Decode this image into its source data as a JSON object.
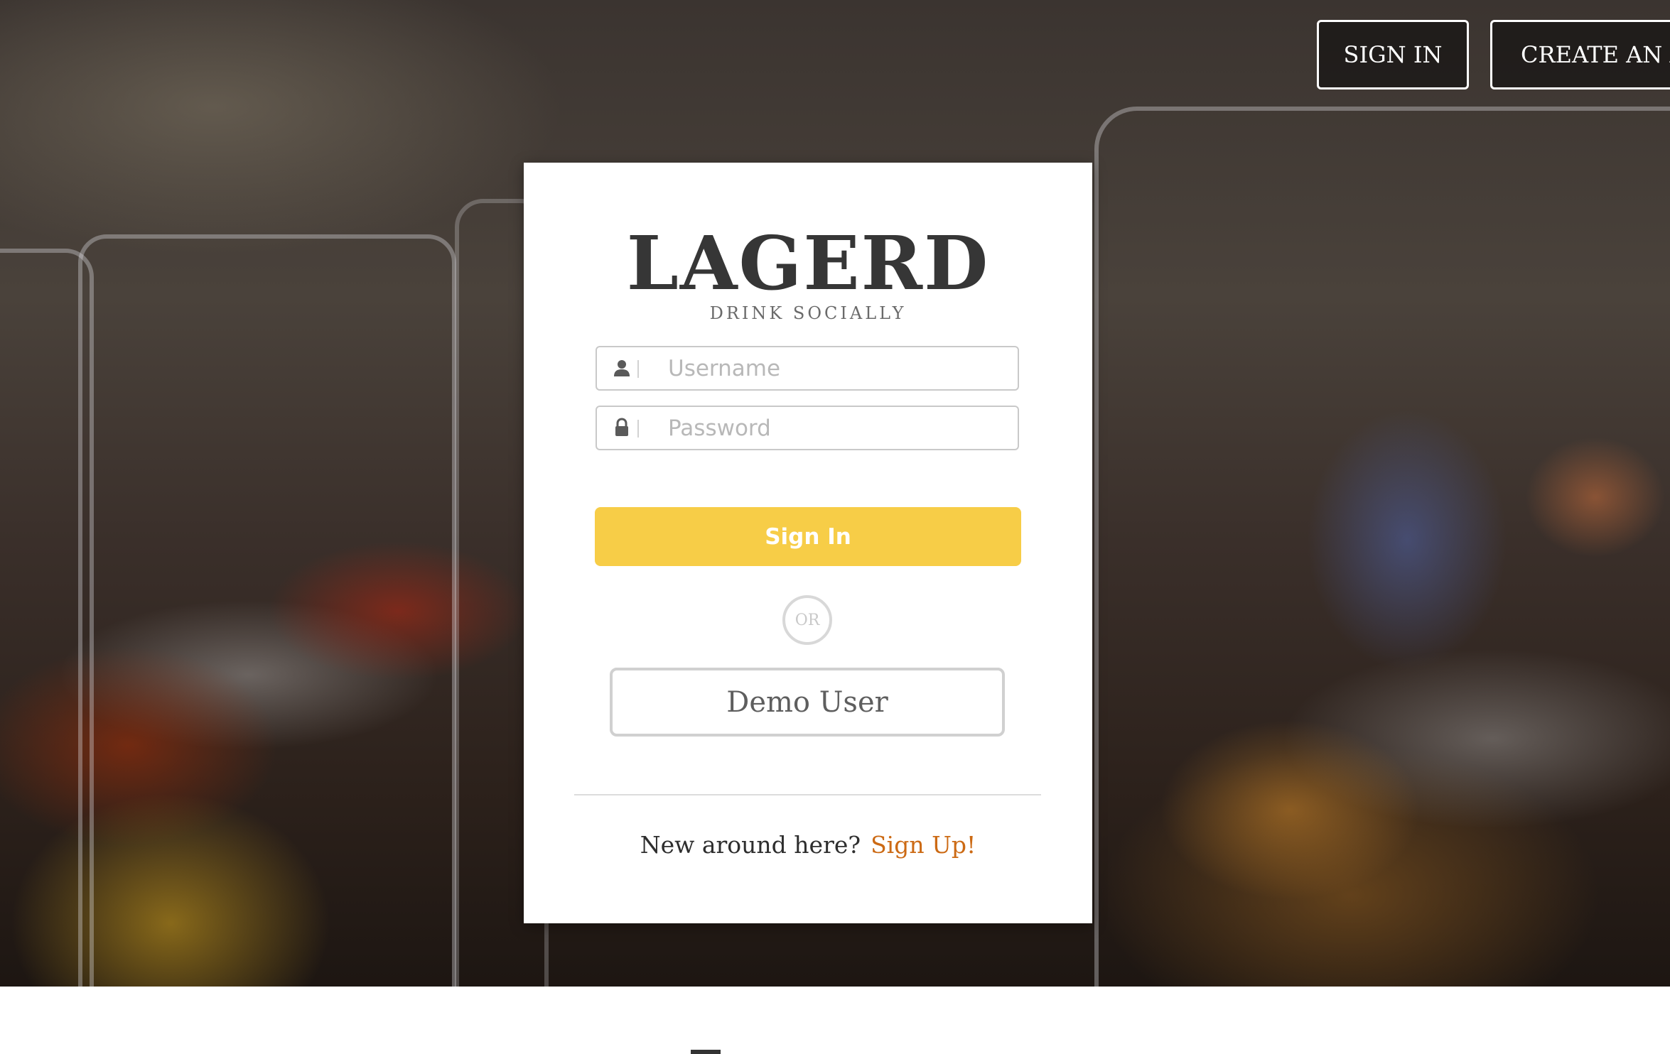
{
  "nav": {
    "signin_label": "SIGN IN",
    "create_label": "CREATE AN A"
  },
  "card": {
    "logo": "LAGERD",
    "tagline": "DRINK SOCIALLY",
    "username_placeholder": "Username",
    "password_placeholder": "Password",
    "signin_button": "Sign In",
    "or_label": "OR",
    "demo_button": "Demo User",
    "signup_prompt": "New around here?",
    "signup_link": "Sign Up!"
  },
  "colors": {
    "accent_yellow": "#f7cd47",
    "link_orange": "#cc6a14",
    "text_dark": "#363636"
  },
  "icons": {
    "username": "user-icon",
    "password": "lock-icon"
  }
}
